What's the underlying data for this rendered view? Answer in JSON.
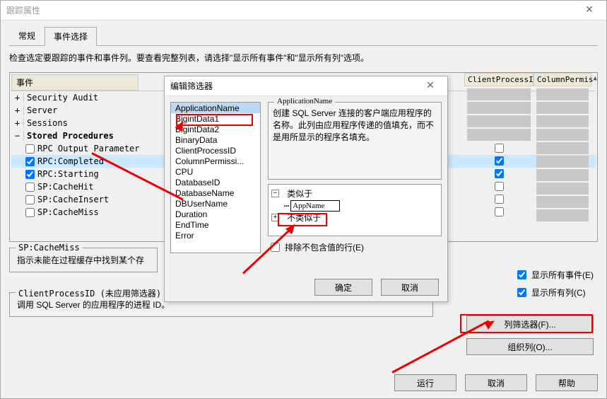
{
  "window": {
    "title": "跟踪属性"
  },
  "tabs": {
    "general": "常规",
    "events": "事件选择"
  },
  "instruction": "检查选定要跟踪的事件和事件列。要查看完整列表，请选择\"显示所有事件\"和\"显示所有列\"选项。",
  "events_header": {
    "col_events": "事件",
    "col_client": "ClientProcessID",
    "col_colperm": "ColumnPermis",
    "arrow": "▲"
  },
  "event_groups": [
    {
      "exp": "+",
      "label": "Security Audit"
    },
    {
      "exp": "+",
      "label": "Server"
    },
    {
      "exp": "+",
      "label": "Sessions"
    },
    {
      "exp": "−",
      "label": "Stored Procedures",
      "bold": true
    }
  ],
  "event_items": [
    {
      "checked": false,
      "label": "RPC Output Parameter"
    },
    {
      "checked": true,
      "label": "RPC:Completed",
      "selected": true
    },
    {
      "checked": true,
      "label": "RPC:Starting"
    },
    {
      "checked": false,
      "label": "SP:CacheHit"
    },
    {
      "checked": false,
      "label": "SP:CacheInsert"
    },
    {
      "checked": false,
      "label": "SP:CacheMiss"
    }
  ],
  "right_checks": [
    false,
    true,
    true,
    false,
    false,
    false
  ],
  "status_group": {
    "legend": "SP:CacheMiss",
    "text": "指示未能在过程缓存中找到某个存"
  },
  "filter_group": {
    "legend": "ClientProcessID (未应用筛选器)",
    "text": "调用 SQL Server 的应用程序的进程 ID。"
  },
  "opts": {
    "show_events": "显示所有事件(E)",
    "show_cols": "显示所有列(C)"
  },
  "buttons": {
    "col_filter": "列筛选器(F)...",
    "org_cols": "组织列(O)...",
    "run": "运行",
    "cancel": "取消",
    "help": "帮助"
  },
  "dialog": {
    "title": "编辑筛选器",
    "col_label": "ApplicationName",
    "items": [
      "ApplicationName",
      "BigintData1",
      "BigintData2",
      "BinaryData",
      "ClientProcessID",
      "ColumnPermissi...",
      "CPU",
      "DatabaseID",
      "DatabaseName",
      "DBUserName",
      "Duration",
      "EndTime",
      "Error"
    ],
    "desc": "创建 SQL Server 连接的客户端应用程序的名称。此列由应用程序传递的值填充，而不是用所显示的程序名填充。",
    "tree": {
      "like": "类似于",
      "notlike": "不类似于",
      "input": "AppName"
    },
    "exclude": "排除不包含值的行(E)",
    "ok": "确定",
    "cancel": "取消"
  }
}
